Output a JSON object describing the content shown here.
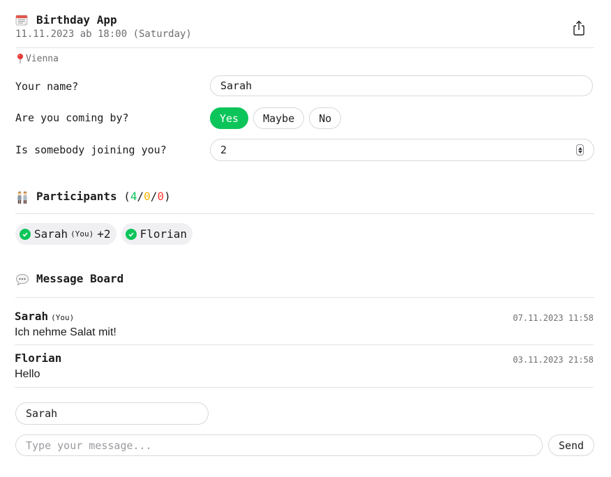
{
  "header": {
    "title": "Birthday App",
    "date": "11.11.2023 ab 18:00 (Saturday)",
    "location": "Vienna",
    "calendar_icon": "calendar-icon",
    "share_icon": "share-icon"
  },
  "form": {
    "name_label": "Your name?",
    "name_value": "Sarah",
    "coming_label": "Are you coming by?",
    "options": [
      "Yes",
      "Maybe",
      "No"
    ],
    "selected_option": "Yes",
    "joining_label": "Is somebody joining you?",
    "joining_value": "2"
  },
  "participants": {
    "heading": "Participants",
    "count_yes": "4",
    "count_maybe": "0",
    "count_no": "0",
    "list": [
      {
        "name": "Sarah",
        "you_tag": "(You)",
        "extra": "+2"
      },
      {
        "name": "Florian"
      }
    ]
  },
  "messages": {
    "heading": "Message Board",
    "items": [
      {
        "author": "Sarah",
        "you_tag": "(You)",
        "time": "07.11.2023 11:58",
        "text": "Ich nehme Salat mit!"
      },
      {
        "author": "Florian",
        "time": "03.11.2023 21:58",
        "text": "Hello"
      }
    ]
  },
  "compose": {
    "author_value": "Sarah",
    "message_placeholder": "Type your message...",
    "send_label": "Send"
  },
  "colors": {
    "accent_green": "#0cc55a",
    "maybe_yellow": "#f3b300",
    "no_red": "#ff3b30"
  }
}
